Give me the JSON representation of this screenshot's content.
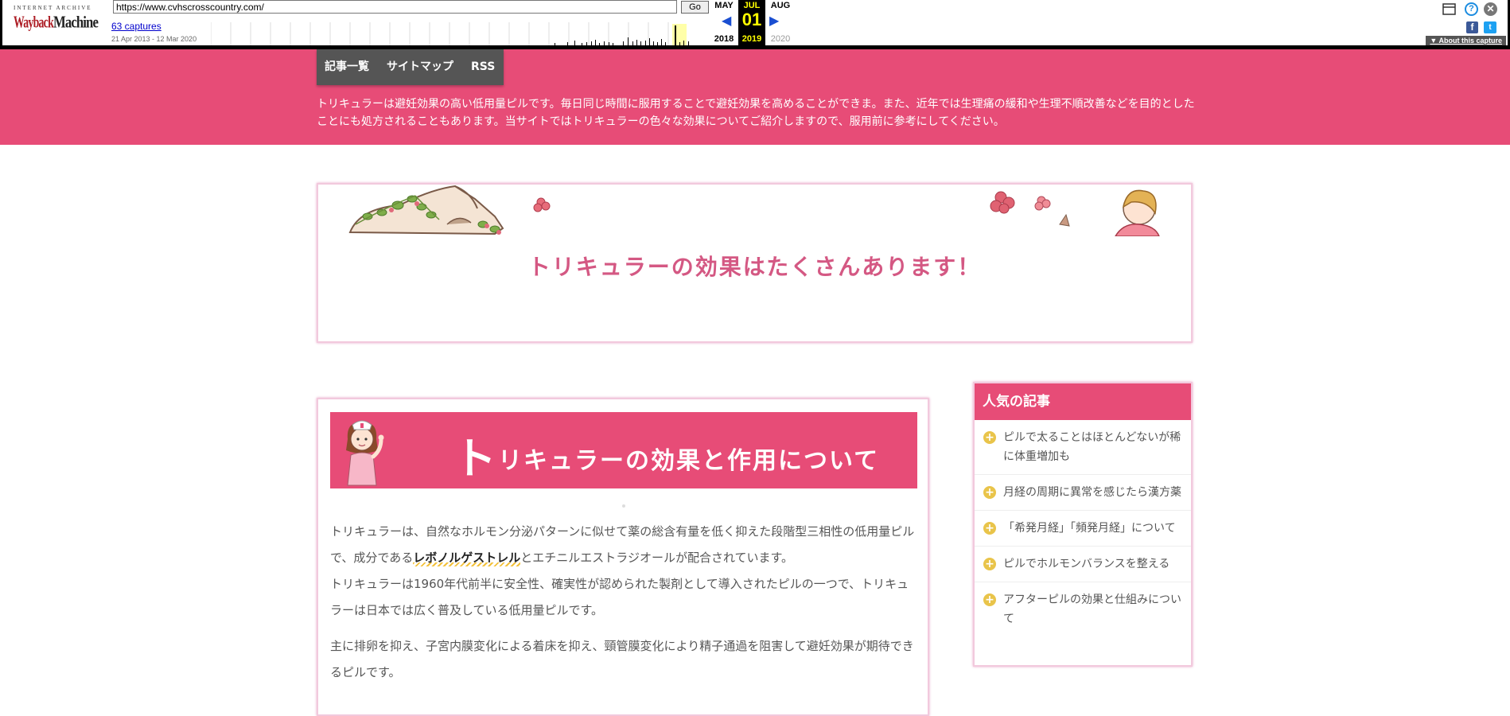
{
  "wayback": {
    "logo_top": "INTERNET ARCHIVE",
    "logo_main": "WaybackMachine",
    "url": "https://www.cvhscrosscountry.com/",
    "go_label": "Go",
    "captures_link": "63 captures",
    "date_range": "21 Apr 2013 - 12 Mar 2020",
    "calendar": {
      "prev_month": "MAY",
      "prev_year": "2018",
      "cur_month": "JUL",
      "cur_day": "01",
      "cur_year": "2019",
      "next_month": "AUG",
      "next_year": "2020"
    },
    "about_label": "About this capture",
    "icons": [
      "window-icon",
      "help-icon",
      "close-icon",
      "facebook-icon",
      "twitter-icon"
    ]
  },
  "nav": {
    "items": [
      "記事一覧",
      "サイトマップ",
      "RSS"
    ]
  },
  "site_description": "トリキュラーは避妊効果の高い低用量ピルです。毎日同じ時間に服用することで避妊効果を高めることができま。また、近年では生理痛の緩和や生理不順改善などを目的としたことにも処方されることもあります。当サイトではトリキュラーの色々な効果についてご紹介しますので、服用前に参考にしてください。",
  "hero": {
    "title": "トリキュラーの効果はたくさんあります！"
  },
  "article": {
    "title_first": "ト",
    "title_rest": "リキュラーの効果と作用について",
    "p1_before": "トリキュラーは、自然なホルモン分泌パターンに似せて薬の総含有量を低く抑えた段階型三相性の低用量ピルで、成分である",
    "p1_highlight": "レボノルゲストレル",
    "p1_after": "とエチニルエストラジオールが配合されています。",
    "p2": "トリキュラーは1960年代前半に安全性、確実性が認められた製剤として導入されたピルの一つで、トリキュラーは日本では広く普及している低用量ピルです。",
    "p3": "主に排卵を抑え、子宮内膜変化による着床を抑え、頸管膜変化により精子通過を阻害して避妊効果が期待できるピルです。"
  },
  "sidebar": {
    "title": "人気の記事",
    "items": [
      "ピルで太ることはほとんどないが稀に体重増加も",
      "月経の周期に異常を感じたら漢方薬",
      "「希発月経」「頻発月経」について",
      "ピルでホルモンバランスを整える",
      "アフターピルの効果と仕組みについて"
    ]
  },
  "colors": {
    "brand_pink": "#e74c77",
    "hero_title": "#d45883",
    "bullet": "#e9c44a",
    "nav_bg": "#555555"
  }
}
